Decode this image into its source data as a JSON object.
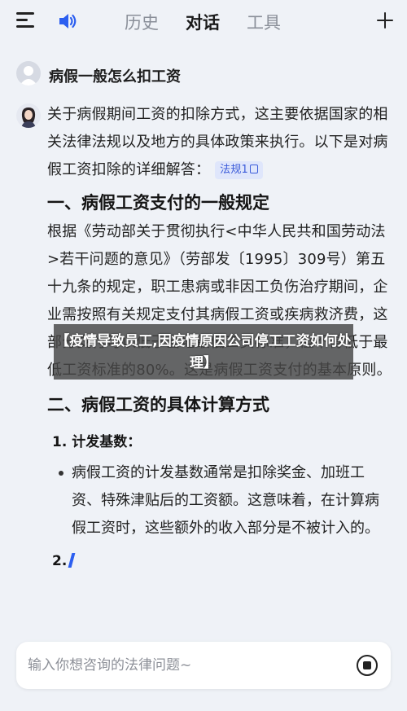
{
  "header": {
    "tabs": [
      {
        "label": "历史"
      },
      {
        "label": "对话"
      },
      {
        "label": "工具"
      }
    ]
  },
  "conversation": {
    "question": "病假一般怎么扣工资",
    "answer": {
      "intro": "关于病假期间工资的扣除方式，这主要依据国家的相关法律法规以及地方的具体政策来执行。以下是对病假工资扣除的详细解答：",
      "citation": "法规1",
      "section1_title": "一、病假工资支付的一般规定",
      "section1_body": "根据《劳动部关于贯彻执行<中华人民共和国劳动法>若干问题的意见》（劳部发〔1995〕309号）第五十九条的规定，职工患病或非因工负伤治疗期间，企业需按照有关规定支付其病假工资或疾病救济费，这部分支付可以低于当地最低工资标准，但不得低于最低工资标准的80%。这是病假工资支付的基本原则。",
      "section2_title": "二、病假工资的具体计算方式",
      "sub1_title": "1. 计发基数：",
      "sub1_bullet": "病假工资的计发基数通常是扣除奖金、加班工资、特殊津贴后的工资额。这意味着，在计算病假工资时，这些额外的收入部分是不被计入的。",
      "sub2_title": "2."
    }
  },
  "overlay": {
    "caption": "【疫情导致员工,因疫情原因公司停工工资如何处理】"
  },
  "input": {
    "placeholder": "输入你想咨询的法律问题~"
  },
  "colors": {
    "background": "#eff2f7",
    "accent": "#2c5ff0",
    "citation_bg": "#dfe6fb"
  }
}
